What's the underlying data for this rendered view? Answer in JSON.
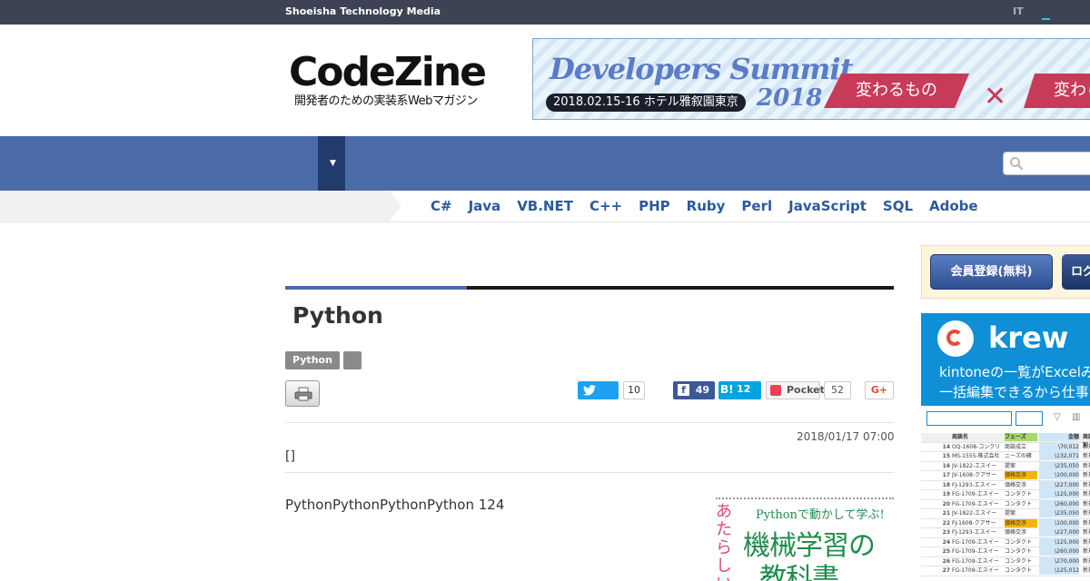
{
  "topbar": {
    "brand": "Shoeisha Technology Media",
    "it_label": "IT"
  },
  "header": {
    "logo_main": "CodeZine",
    "logo_sub": "開発者のための実装系Webマガジン",
    "banner": {
      "title": "Developers Summit",
      "year": "2018",
      "date": "2018.02.15-16 ホテル雅叙園東京",
      "tag1": "変わるもの",
      "tag2": "変わら"
    }
  },
  "nav": {
    "dropdown_arrow": "▼",
    "search_placeholder": ""
  },
  "languages": [
    "C#",
    "Java",
    "VB.NET",
    "C++",
    "PHP",
    "Ruby",
    "Perl",
    "JavaScript",
    "SQL",
    "Adobe"
  ],
  "article": {
    "title": "Python",
    "tags": [
      "Python",
      ""
    ],
    "share": {
      "twitter_count": "10",
      "facebook_count": "49",
      "hatena_label": "B!",
      "hatena_count": "12",
      "pocket_label": "Pocket",
      "pocket_count": "52",
      "gplus_label": "G+"
    },
    "date": "2018/01/17 07:00",
    "bracket": "[]",
    "lead": "PythonPythonPythonPython 124",
    "book": {
      "line1": "Pythonで動かして学ぶ!",
      "line2": "機械学習の",
      "line3": "教科書",
      "side": "あたらしい"
    }
  },
  "sidebar": {
    "register_label": "会員登録(無料)",
    "login_label": "ログ",
    "ad": {
      "brand": "krew",
      "line1": "kintoneの一覧がExcelみたいに",
      "line2": "一括編集できるから仕事が",
      "sheet_header": [
        "",
        "商談名",
        "フェーズ",
        "金額",
        "商談種別"
      ],
      "sheet_rows": [
        [
          "14",
          "OQ-1608-コンクリ",
          "商談成立",
          "\\70,012",
          "新規"
        ],
        [
          "15",
          "MS-1555-株式会社",
          "ニーズの確",
          "\\132,071",
          "新規"
        ],
        [
          "16",
          "JV-1822-エスイー",
          "提案",
          "\\235,050",
          "新規"
        ],
        [
          "17",
          "JV-1608-クアサー",
          "価格交渉",
          "\\100,000",
          "新規"
        ],
        [
          "18",
          "FJ-1293-エスイー",
          "価格交渉",
          "\\227,000",
          "新規"
        ],
        [
          "19",
          "FG-1709-エスイー",
          "コンタクト",
          "\\125,000",
          "新規"
        ],
        [
          "20",
          "FG-1709-エスイー",
          "コンタクト",
          "\\260,000",
          "新規"
        ],
        [
          "21",
          "JV-1822-エスイー",
          "提案",
          "\\235,050",
          "新規"
        ],
        [
          "22",
          "FJ-1608-クアサー",
          "価格交渉",
          "\\100,000",
          "新規"
        ],
        [
          "23",
          "FJ-1293-エスイー",
          "価格交渉",
          "\\227,000",
          "新規"
        ],
        [
          "24",
          "FG-1709-エスイー",
          "コンタクト",
          "\\125,000",
          "新規"
        ],
        [
          "25",
          "FG-1709-エスイー",
          "コンタクト",
          "\\260,000",
          "新規"
        ],
        [
          "26",
          "FG-1709-エスイー",
          "コンタクト",
          "\\270,000",
          "新規"
        ],
        [
          "27",
          "FG-1709-エスイー",
          "コンタクト",
          "\\125,012",
          "新規"
        ]
      ]
    }
  },
  "colors": {
    "nav": "#4a6ba8",
    "accent_dark": "#233b6c",
    "link": "#2c5a9c",
    "topbar": "#3d4354"
  }
}
